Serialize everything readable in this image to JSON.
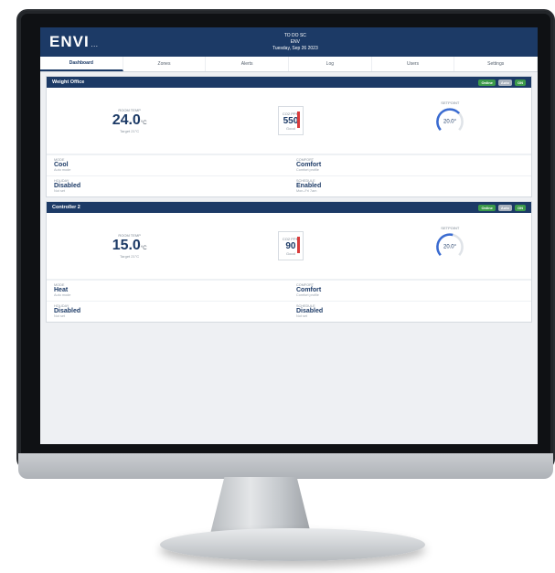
{
  "brand": {
    "name": "ENVI",
    "tag": "..."
  },
  "header": {
    "line1": "TO DO SC",
    "line2": "ENV",
    "line3": "Tuesday, Sep 26 2023"
  },
  "tabs": [
    "Dashboard",
    "Zones",
    "Alerts",
    "Log",
    "Users",
    "Settings"
  ],
  "panels": [
    {
      "title": "Weight Office",
      "chips": [
        "Online",
        "Auto",
        "ON"
      ],
      "room_temp": {
        "label": "Room Temp",
        "value": "24.0",
        "unit": "°C",
        "sub": "Target 21°C"
      },
      "co2": {
        "label": "CO2 PPM",
        "value": "550",
        "sub": "Good"
      },
      "setpoint": {
        "label": "Setpoint",
        "value": "20.0°",
        "fill_fraction": 0.68
      },
      "info": [
        {
          "label": "Mode",
          "value": "Cool",
          "sub": "Auto mode"
        },
        {
          "label": "Comfort",
          "value": "Comfort",
          "sub": "Comfort profile"
        },
        {
          "label": "Holiday",
          "value": "Disabled",
          "sub": "Not set"
        },
        {
          "label": "Schedule",
          "value": "Enabled",
          "sub": "Mon–Fri 7am"
        }
      ]
    },
    {
      "title": "Controller 2",
      "chips": [
        "Online",
        "Auto",
        "ON"
      ],
      "room_temp": {
        "label": "Room Temp",
        "value": "15.0",
        "unit": "°C",
        "sub": "Target 21°C"
      },
      "co2": {
        "label": "CO2 PPM",
        "value": "90",
        "sub": "Good"
      },
      "setpoint": {
        "label": "Setpoint",
        "value": "20.0°",
        "fill_fraction": 0.55
      },
      "info": [
        {
          "label": "Mode",
          "value": "Heat",
          "sub": "Auto mode"
        },
        {
          "label": "Comfort",
          "value": "Comfort",
          "sub": "Comfort profile"
        },
        {
          "label": "Holiday",
          "value": "Disabled",
          "sub": "Not set"
        },
        {
          "label": "Schedule",
          "value": "Disabled",
          "sub": "Not set"
        }
      ]
    }
  ],
  "colors": {
    "primary": "#1c3a66",
    "accent_red": "#d83b3b",
    "accent_blue": "#3a6bd1",
    "online": "#3c9a4a"
  }
}
